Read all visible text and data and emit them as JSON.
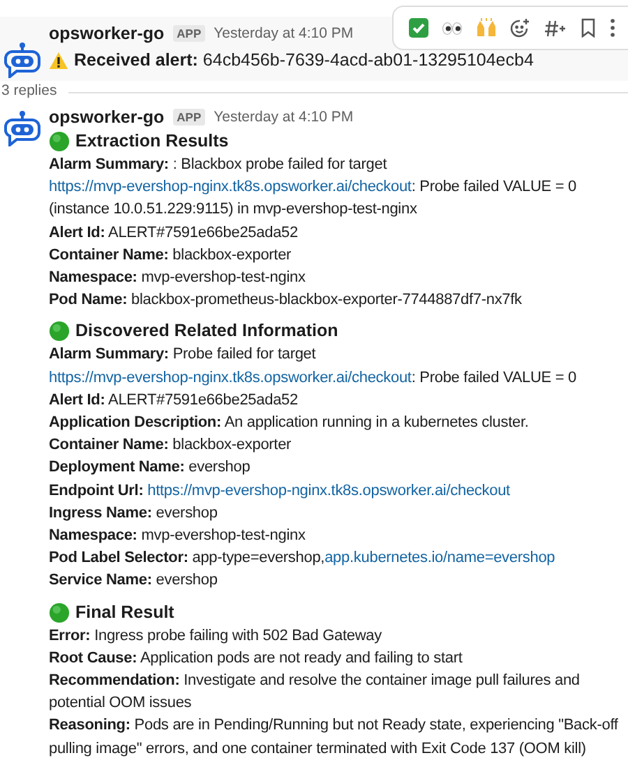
{
  "alert_message": {
    "sender": "opsworker-go",
    "badge": "APP",
    "time": "Yesterday at 4:10 PM",
    "hovered": true,
    "alert_label": "Received alert:",
    "alert_id": "64cb456b-7639-4acd-ab01-13295104ecb4"
  },
  "thread": {
    "replies": "3 replies"
  },
  "reply_message": {
    "sender": "opsworker-go",
    "badge": "APP",
    "time": "Yesterday at 4:10 PM",
    "sections": [
      {
        "title": "Extraction Results",
        "fields": [
          {
            "label": "Alarm Summary:",
            "parts": [
              {
                "kind": "text",
                "text": " : Blackbox probe failed for target "
              },
              {
                "kind": "link",
                "text": "https://mvp-evershop-nginx.tk8s.opsworker.ai/checkout"
              },
              {
                "kind": "text",
                "text": ": Probe failed  VALUE = 0  (instance 10.0.51.229:9115) in mvp-evershop-test-nginx"
              }
            ]
          },
          {
            "label": "Alert Id:",
            "parts": [
              {
                "kind": "text",
                "text": " ALERT#7591e66be25ada52"
              }
            ]
          },
          {
            "label": "Container Name:",
            "parts": [
              {
                "kind": "text",
                "text": " blackbox-exporter"
              }
            ]
          },
          {
            "label": "Namespace:",
            "parts": [
              {
                "kind": "text",
                "text": " mvp-evershop-test-nginx"
              }
            ]
          },
          {
            "label": "Pod Name:",
            "parts": [
              {
                "kind": "text",
                "text": " blackbox-prometheus-blackbox-exporter-7744887df7-nx7fk"
              }
            ]
          }
        ]
      },
      {
        "title": "Discovered Related Information",
        "fields": [
          {
            "label": "Alarm Summary:",
            "parts": [
              {
                "kind": "text",
                "text": " Probe failed for target "
              },
              {
                "kind": "link",
                "text": "https://mvp-evershop-nginx.tk8s.opsworker.ai/checkout"
              },
              {
                "kind": "text",
                "text": ": Probe failed VALUE = 0"
              }
            ]
          },
          {
            "label": "Alert Id:",
            "parts": [
              {
                "kind": "text",
                "text": " ALERT#7591e66be25ada52"
              }
            ]
          },
          {
            "label": "Application Description:",
            "parts": [
              {
                "kind": "text",
                "text": " An application running in a kubernetes cluster."
              }
            ]
          },
          {
            "label": "Container Name:",
            "parts": [
              {
                "kind": "text",
                "text": " blackbox-exporter"
              }
            ]
          },
          {
            "label": "Deployment Name:",
            "parts": [
              {
                "kind": "text",
                "text": " evershop"
              }
            ]
          },
          {
            "label": "Endpoint Url:",
            "parts": [
              {
                "kind": "link",
                "text": "https://mvp-evershop-nginx.tk8s.opsworker.ai/checkout"
              }
            ]
          },
          {
            "label": "Ingress Name:",
            "parts": [
              {
                "kind": "text",
                "text": " evershop"
              }
            ]
          },
          {
            "label": "Namespace:",
            "parts": [
              {
                "kind": "text",
                "text": " mvp-evershop-test-nginx"
              }
            ]
          },
          {
            "label": "Pod Label Selector:",
            "parts": [
              {
                "kind": "text",
                "text": " app-type=evershop,"
              },
              {
                "kind": "link",
                "text": "app.kubernetes.io/name=evershop"
              }
            ]
          },
          {
            "label": "Service Name:",
            "parts": [
              {
                "kind": "text",
                "text": " evershop"
              }
            ]
          }
        ]
      },
      {
        "title": "Final Result",
        "fields": [
          {
            "label": "Error:",
            "parts": [
              {
                "kind": "text",
                "text": " Ingress probe failing with 502 Bad Gateway"
              }
            ]
          },
          {
            "label": "Root Cause:",
            "parts": [
              {
                "kind": "text",
                "text": " Application pods are not ready and failing to start"
              }
            ]
          },
          {
            "label": "Recommendation:",
            "parts": [
              {
                "kind": "text",
                "text": " Investigate and resolve the container image pull failures and potential OOM issues"
              }
            ]
          },
          {
            "label": "Reasoning:",
            "parts": [
              {
                "kind": "text",
                "text": " Pods are in Pending/Running but not Ready state, experiencing \"Back-off pulling image\" errors, and one container terminated with Exit Code 137 (OOM kill)"
              }
            ]
          }
        ]
      }
    ]
  }
}
